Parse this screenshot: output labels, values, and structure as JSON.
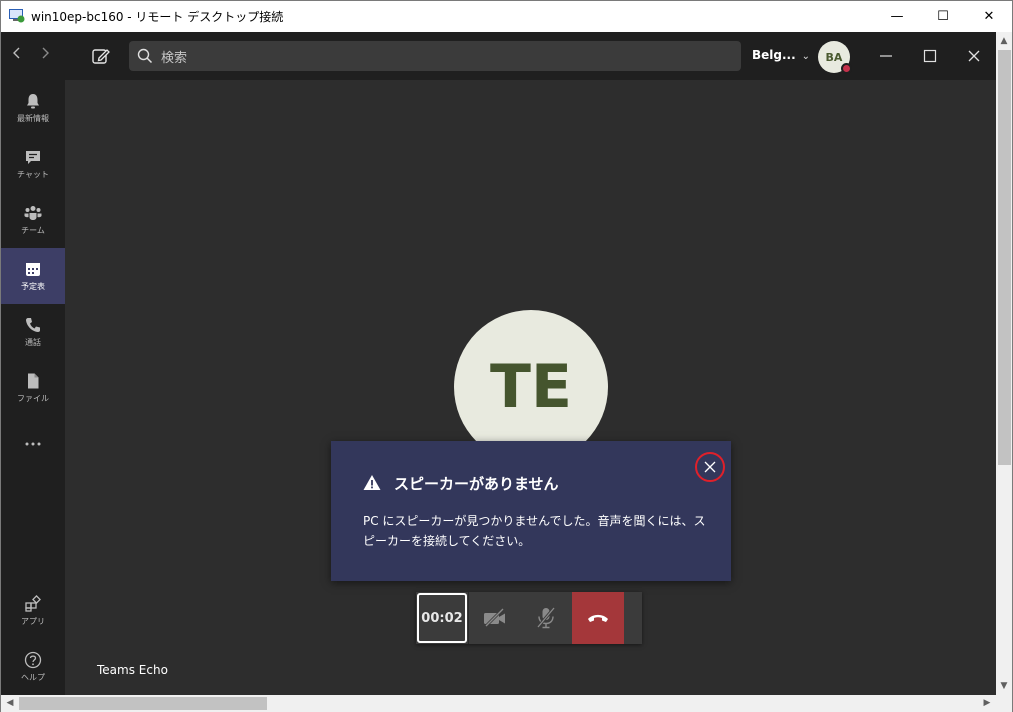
{
  "window": {
    "title": "win10ep-bc160 - リモート デスクトップ接続",
    "minimize_glyph": "—",
    "maximize_glyph": "☐",
    "close_glyph": "✕"
  },
  "teams": {
    "search_placeholder": "検索",
    "org_name": "Belg...",
    "user_initials": "BA",
    "rail": [
      {
        "label": "最新情報",
        "icon": "bell-icon"
      },
      {
        "label": "チャット",
        "icon": "chat-icon"
      },
      {
        "label": "チーム",
        "icon": "teams-icon"
      },
      {
        "label": "予定表",
        "icon": "calendar-icon"
      },
      {
        "label": "通話",
        "icon": "phone-icon"
      },
      {
        "label": "ファイル",
        "icon": "file-icon"
      },
      {
        "label": "",
        "icon": "more-icon"
      },
      {
        "label": "アプリ",
        "icon": "apps-icon"
      },
      {
        "label": "ヘルプ",
        "icon": "help-icon"
      }
    ],
    "active_rail_item": "予定表"
  },
  "call": {
    "callee_initials": "TE",
    "callee_name": "Teams Echo",
    "timer": "00:02"
  },
  "toast": {
    "title": "スピーカーがありません",
    "body": "PC にスピーカーが見つかりませんでした。音声を聞くには、スピーカーを接続してください。"
  },
  "colors": {
    "accent": "#3d3e66",
    "toast_bg": "#33375b",
    "hangup": "#a4373a",
    "presence_busy": "#c4314b",
    "highlight_circle": "#e0202a"
  }
}
